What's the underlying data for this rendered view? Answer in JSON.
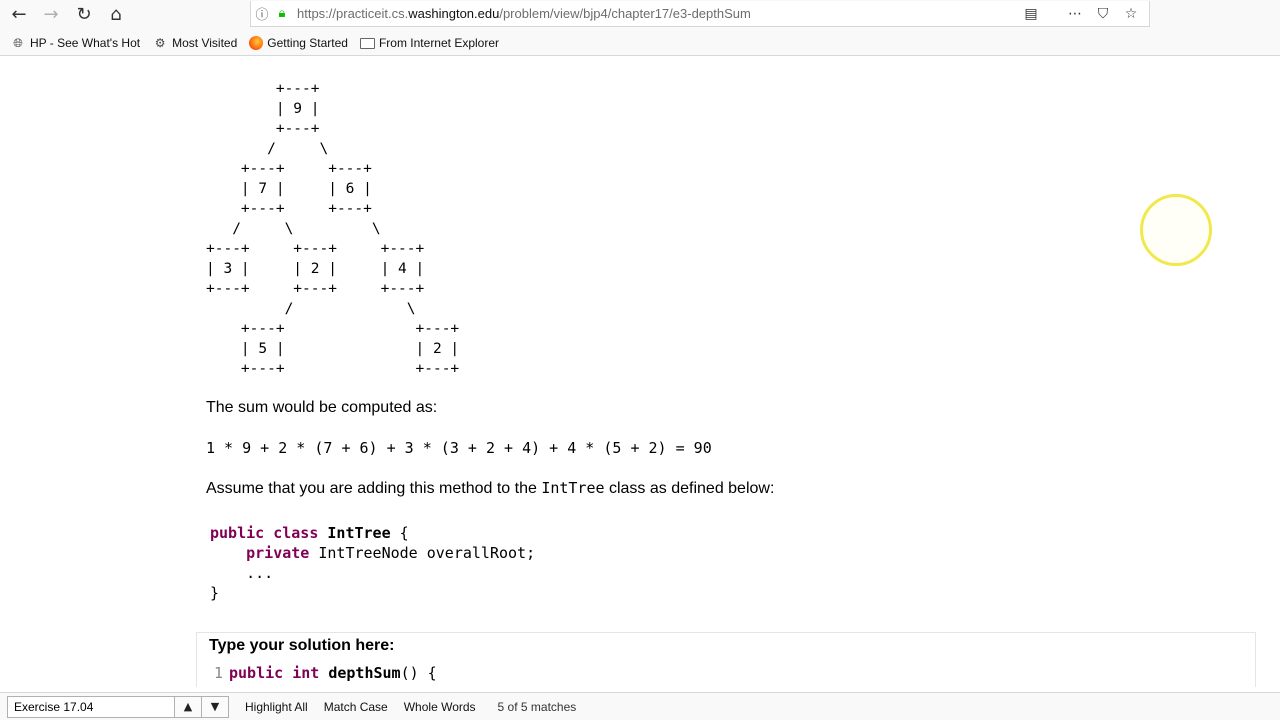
{
  "browser": {
    "url_prefix": "https://practiceit.cs.",
    "url_host": "washington.edu",
    "url_path": "/problem/view/bjp4/chapter17/e3-depthSum",
    "icons": {
      "back": "back-arrow-icon",
      "forward": "forward-arrow-icon",
      "reload": "reload-icon",
      "home": "home-icon",
      "info": "info-icon",
      "lock": "lock-icon",
      "reader": "reader-view-icon",
      "more": "more-dots-icon",
      "pocket": "pocket-icon",
      "bookmark": "star-icon"
    }
  },
  "bookmarks": [
    {
      "label": "HP - See What's Hot",
      "icon": "globe-icon"
    },
    {
      "label": "Most Visited",
      "icon": "gear-icon"
    },
    {
      "label": "Getting Started",
      "icon": "firefox-icon"
    },
    {
      "label": "From Internet Explorer",
      "icon": "folder-icon"
    }
  ],
  "content": {
    "ascii_tree": "        +---+\n        | 9 |\n        +---+\n       /     \\\n    +---+     +---+\n    | 7 |     | 6 |\n    +---+     +---+\n   /     \\         \\\n+---+     +---+     +---+\n| 3 |     | 2 |     | 4 |\n+---+     +---+     +---+\n         /             \\\n    +---+               +---+\n    | 5 |               | 2 |\n    +---+               +---+",
    "sum_intro": "The sum would be computed as:",
    "formula": "1 * 9 + 2 * (7 + 6) + 3 * (3 + 2 + 4) + 4 * (5 + 2) = 90",
    "assume_before": "Assume that you are adding this method to the ",
    "assume_class": "IntTree",
    "assume_after": " class as defined below:",
    "code": {
      "line1_kw1": "public",
      "line1_kw2": "class",
      "line1_type": "IntTree",
      "line1_rest": " {",
      "line2_indent": "    ",
      "line2_kw": "private",
      "line2_rest": " IntTreeNode overallRoot;",
      "line3": "    ...",
      "line4": "}"
    },
    "solution_title": "Type your solution here:",
    "editor": {
      "line_number": "1",
      "kw1": "public",
      "kw2": "int",
      "method": "depthSum",
      "rest": "() {"
    }
  },
  "findbar": {
    "search_value": "Exercise 17.04",
    "highlight_all": "Highlight All",
    "match_case": "Match Case",
    "whole_words": "Whole Words",
    "status": "5 of 5 matches"
  }
}
